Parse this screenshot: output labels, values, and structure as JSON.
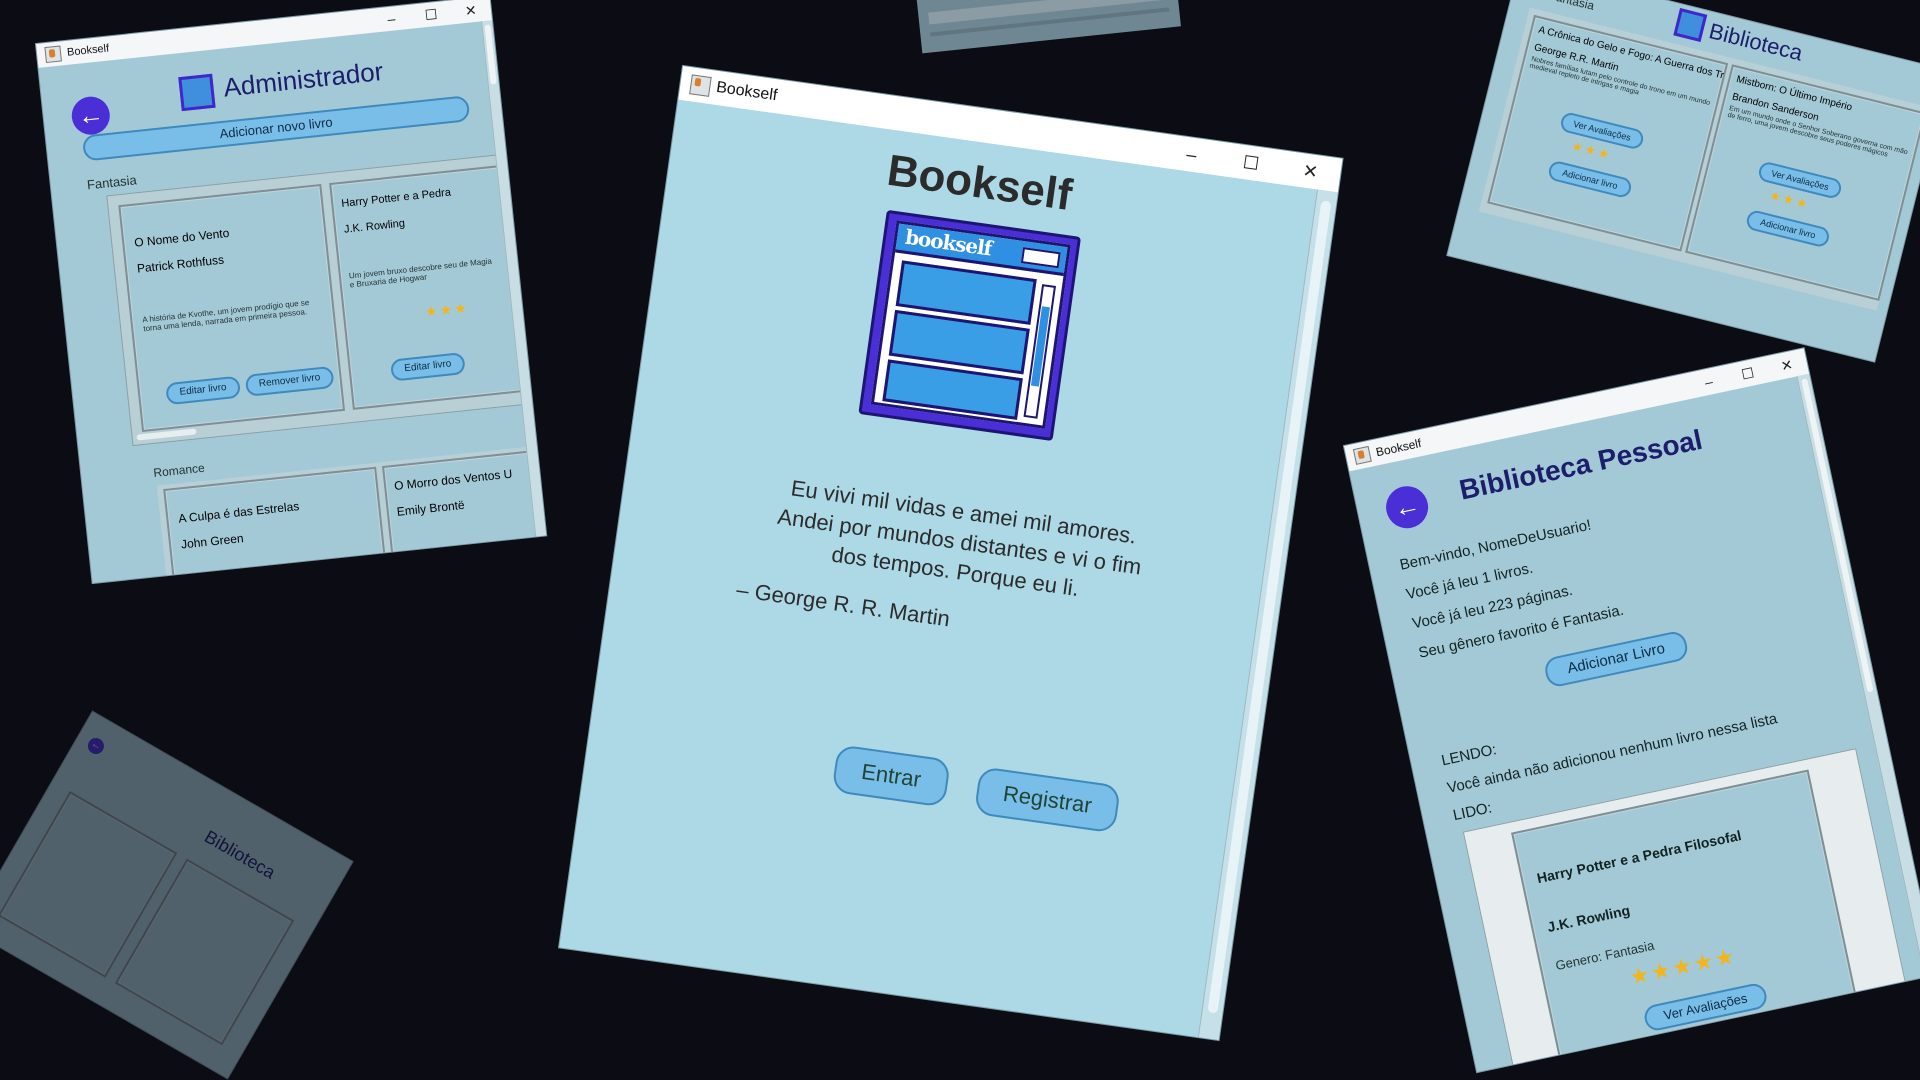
{
  "app_title": "Bookself",
  "window_controls": {
    "minimize": "–",
    "maximize": "☐",
    "close": "✕"
  },
  "login": {
    "heading": "Bookself",
    "logo_text": "bookself",
    "quote_line1": "Eu vivi mil vidas e amei mil amores.",
    "quote_line2": "Andei por mundos distantes e vi o fim",
    "quote_line3": "dos tempos. Porque eu li.",
    "quote_author": "– George R. R. Martin",
    "enter_label": "Entrar",
    "register_label": "Registrar"
  },
  "admin": {
    "title": "Administrador",
    "add_book_label": "Adicionar novo livro",
    "genre_fantasy": "Fantasia",
    "genre_romance": "Romance",
    "book1": {
      "title": "O Nome do Vento",
      "author": "Patrick Rothfuss",
      "desc": "A história de Kvothe, um jovem prodígio que se torna uma lenda, narrada em primeira pessoa."
    },
    "book2": {
      "title": "Harry Potter e a Pedra",
      "author": "J.K. Rowling",
      "desc": "Um jovem bruxo descobre seu de Magia e Bruxaria de Hogwar"
    },
    "book3": {
      "title": "A Culpa é das Estrelas",
      "author": "John Green"
    },
    "book4": {
      "title": "O Morro dos Ventos U",
      "author": "Emily Brontë"
    },
    "edit_label": "Editar livro",
    "remove_label": "Remover livro",
    "stars": "★★★"
  },
  "library": {
    "title": "Biblioteca",
    "genre": "Fantasia",
    "book1": {
      "title": "A Crônica do Gelo e Fogo: A Guerra dos Tr",
      "author": "George R.R. Martin",
      "desc": "Nobres famílias lutam pelo controle do trono em um mundo medieval repleto de intrigas e magia"
    },
    "book2": {
      "title": "Mistborn: O Último Império",
      "author": "Brandon Sanderson",
      "desc": "Em um mundo onde o Senhor Soberano governa com mão de ferro, uma jovem descobre seus poderes mágicos"
    },
    "reviews_label": "Ver Avaliações",
    "add_label": "Adicionar livro",
    "stars": "★★★"
  },
  "personal": {
    "title": "Biblioteca Pessoal",
    "welcome": "Bem-vindo, NomeDeUsuario!",
    "books_read": "Você já leu 1 livros.",
    "pages_read": "Você já leu 223 páginas.",
    "favorite_genre": "Seu gênero favorito é Fantasia.",
    "add_book_label": "Adicionar Livro",
    "reading_heading": "LENDO:",
    "reading_empty": "Você ainda não adicionou nenhum livro nessa lista",
    "read_heading": "LIDO:",
    "book": {
      "title": "Harry Potter e a Pedra Filosofal",
      "author": "J.K. Rowling",
      "genre": "Genero: Fantasia"
    },
    "stars": "★★★★★",
    "reviews_label": "Ver Avaliações"
  },
  "faded_library": {
    "title": "Biblioteca"
  }
}
